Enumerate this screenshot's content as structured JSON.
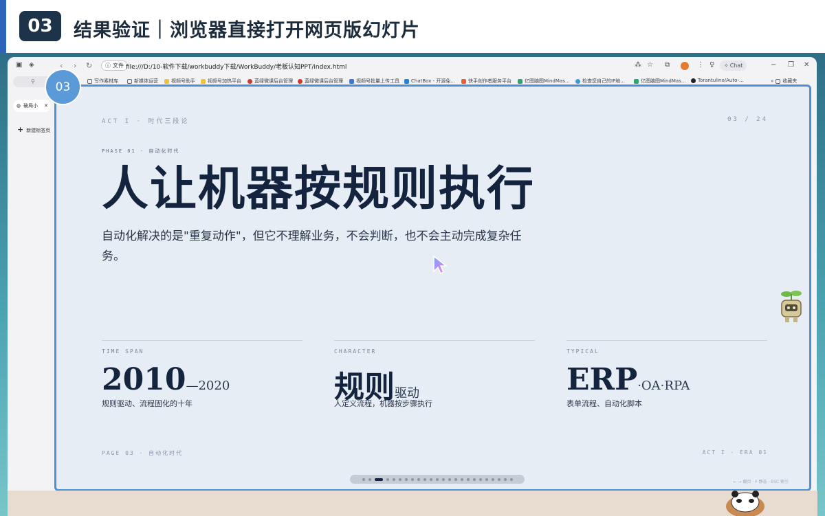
{
  "header": {
    "section_number": "03",
    "title": "结果验证｜浏览器直接打开网页版幻灯片"
  },
  "browser": {
    "url_chip": "文件",
    "url": "file:///D:/10-软件下载/workbuddy下载/WorkBuddy/老板认知PPT/index.html",
    "chat_label": "Chat",
    "bookmarks": [
      "写作素材库",
      "新媒体运营",
      "视频号助手",
      "视频号加热平台",
      "蓝绿微课后台管理",
      "蓝绿微课后台管理",
      "视频号批量上传工具",
      "ChatBox - 开源免...",
      "快手创作者服务平台",
      "亿图脑图MindMas...",
      "检查您自己的IP地...",
      "亿图脑图MindMas...",
      "Torantulino/Auto-..."
    ],
    "bookmarks_more": "收藏夹",
    "active_tab": "破局小",
    "new_tab": "新建标签页"
  },
  "slide": {
    "badge": "03",
    "act_label": "ACT I · 时代三段论",
    "page_count": "03 / 24",
    "phase_label": "PHASE 01 · 自动化时代",
    "headline": "人让机器按规则执行",
    "subtext": "自动化解决的是\"重复动作\"，但它不理解业务，不会判断，也不会主动完成复杂任务。",
    "stats": [
      {
        "label": "TIME SPAN",
        "big": "2010",
        "small": "—2020",
        "desc": "规则驱动、流程固化的十年"
      },
      {
        "label": "CHARACTER",
        "big": "规则",
        "small": "驱动",
        "desc": "人定义流程，机器按步骤执行"
      },
      {
        "label": "TYPICAL",
        "big": "ERP",
        "small": "·OA·RPA",
        "desc": "表单流程、自动化脚本"
      }
    ],
    "footer_left": "PAGE 03 · 自动化时代",
    "footer_right": "ACT I · ERA 01",
    "nav_hint": "← → 翻页 · F 静态 · ESC 索引",
    "progress": {
      "total": 24,
      "current": 3
    }
  },
  "colors": {
    "accent": "#2d63b8",
    "slide_bg": "#e7edf4",
    "slide_border": "#4f8fd4",
    "headline": "#14243e"
  }
}
